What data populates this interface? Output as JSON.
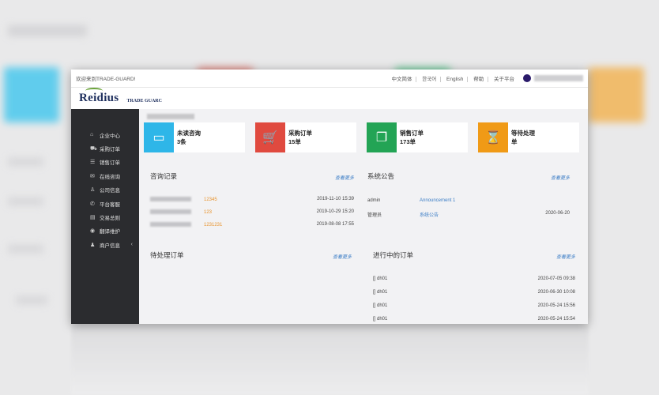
{
  "topbar": {
    "welcome": "欢迎来到TRADE-GUARD!",
    "nav": [
      "中文简体",
      "한국어",
      "English",
      "帮助",
      "关于平台"
    ]
  },
  "brand": {
    "logo": "Reidius",
    "tagline": "TRADE GUARC"
  },
  "sidebar": {
    "items": [
      {
        "icon": "home-icon",
        "glyph": "⌂",
        "label": "企业中心"
      },
      {
        "icon": "cart-icon",
        "glyph": "⛟",
        "label": "采购订单"
      },
      {
        "icon": "list-icon",
        "glyph": "☰",
        "label": "销售订单"
      },
      {
        "icon": "chat-icon",
        "glyph": "✉",
        "label": "在线咨询"
      },
      {
        "icon": "company-icon",
        "glyph": "♙",
        "label": "公司信息"
      },
      {
        "icon": "phone-icon",
        "glyph": "✆",
        "label": "平台客服"
      },
      {
        "icon": "document-icon",
        "glyph": "▤",
        "label": "交易总则"
      },
      {
        "icon": "globe-icon",
        "glyph": "◉",
        "label": "翻译维护"
      },
      {
        "icon": "user-icon",
        "glyph": "♟",
        "label": "商户信息"
      }
    ]
  },
  "cards": [
    {
      "title": "未读咨询",
      "count": "3条",
      "color": "#2eb6e8",
      "icon": "chat-bubble-icon",
      "glyph": "▭"
    },
    {
      "title": "采购订单",
      "count": "15单",
      "color": "#e04a3f",
      "icon": "shopping-cart-icon",
      "glyph": "🛒"
    },
    {
      "title": "销售订单",
      "count": "173单",
      "color": "#23a455",
      "icon": "documents-icon",
      "glyph": "❐"
    },
    {
      "title": "等待处理",
      "count": "单",
      "color": "#f09a16",
      "icon": "hourglass-icon",
      "glyph": "⌛"
    }
  ],
  "consult": {
    "title": "咨询记录",
    "more": "查看更多",
    "rows": [
      {
        "id": "12345",
        "time": "2019-11-10 15:39"
      },
      {
        "id": "123",
        "time": "2019-10-29 15:20"
      },
      {
        "id": "1231231",
        "time": "2019-08-08 17:55"
      }
    ]
  },
  "notice": {
    "title": "系统公告",
    "more": "查看更多",
    "rows": [
      {
        "author": "admin",
        "subject": "Announcement 1",
        "date": ""
      },
      {
        "author": "管理员",
        "subject": "系统公告",
        "date": "2020-06-20"
      }
    ]
  },
  "pending": {
    "title": "待处理订单",
    "more": "查看更多"
  },
  "ongoing": {
    "title": "进行中的订单",
    "more": "查看更多",
    "rows": [
      {
        "name": "[] dh01",
        "time": "2020-07-05 09:38"
      },
      {
        "name": "[] dh01",
        "time": "2020-06-30 10:08"
      },
      {
        "name": "[] dh01",
        "time": "2020-05-24 15:56"
      },
      {
        "name": "[] dh01",
        "time": "2020-05-24 15:54"
      }
    ]
  }
}
